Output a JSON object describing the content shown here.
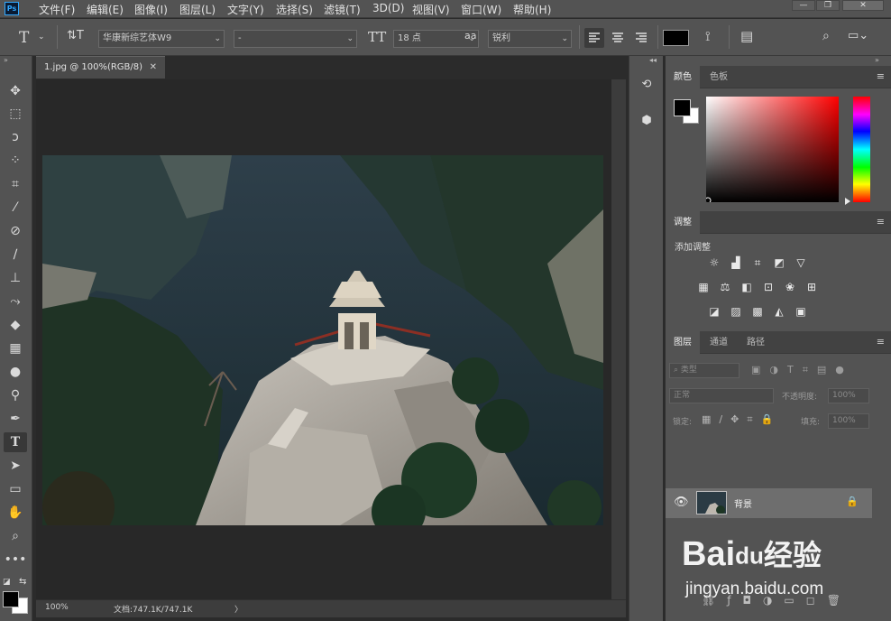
{
  "app": {
    "logo": "Ps"
  },
  "menu": [
    "文件(F)",
    "编辑(E)",
    "图像(I)",
    "图层(L)",
    "文字(Y)",
    "选择(S)",
    "滤镜(T)",
    "3D(D)",
    "视图(V)",
    "窗口(W)",
    "帮助(H)"
  ],
  "window_controls": {
    "minimize": "—",
    "restore": "❐",
    "close": "✕"
  },
  "options": {
    "font_family": "华康新综艺体W9",
    "font_style": "-",
    "font_size": "18 点",
    "antialias_label": "aa",
    "antialias": "锐利",
    "text_color": "#000000"
  },
  "document": {
    "tab_title": "1.jpg @ 100%(RGB/8)",
    "tab_close": "✕",
    "zoom": "100%",
    "doc_size": "文档:747.1K/747.1K",
    "status_arrow": "〉"
  },
  "panels": {
    "color_tabs": [
      "颜色",
      "色板"
    ],
    "adjustments_tab": "调整",
    "adjustments_add_label": "添加调整",
    "layers_tabs": [
      "图层",
      "通道",
      "路径"
    ],
    "filter_kind": "类型",
    "blend_mode": "正常",
    "opacity_label": "不透明度:",
    "opacity_value": "100%",
    "lock_label": "锁定:",
    "fill_label": "填充:",
    "fill_value": "100%",
    "layer_name": "背景",
    "panel_menu_glyph": "≡",
    "collapse_glyph": "»",
    "expand_glyph": "◂◂"
  },
  "colors": {
    "foreground": "#000000",
    "background": "#ffffff",
    "ui_dark": "#535353",
    "selected_layer": "#6e6e6e"
  },
  "watermark": {
    "brand": "Bai",
    "brand_paw": "du",
    "brand_cn": "经验",
    "url": "jingyan.baidu.com"
  }
}
